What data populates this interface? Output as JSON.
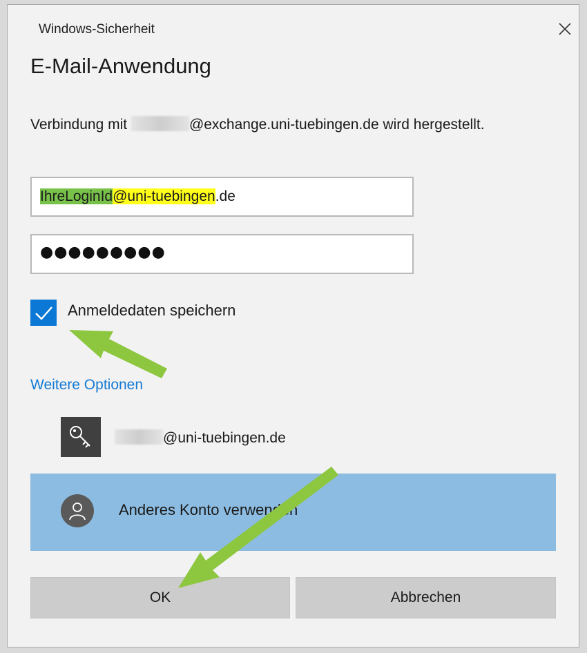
{
  "window": {
    "title": "Windows-Sicherheit",
    "close_icon": "close-icon"
  },
  "dialog": {
    "heading": "E-Mail-Anwendung",
    "description_prefix": "Verbindung mit",
    "description_suffix": "@exchange.uni-tuebingen.de wird hergestellt."
  },
  "username_field": {
    "value_part1": "IhreLoginId",
    "value_part2": "@uni-tuebingen",
    "value_part3": ".de",
    "highlight_colors": [
      "#79c24a",
      "#ffff1a"
    ]
  },
  "password_field": {
    "masked_value": "●●●●●●●●●"
  },
  "remember_credentials": {
    "label": "Anmeldedaten speichern",
    "checked": true
  },
  "more_options": {
    "label": "Weitere Optionen"
  },
  "saved_account": {
    "icon": "key-icon",
    "email_suffix": "@uni-tuebingen.de"
  },
  "other_account": {
    "icon": "user-icon",
    "label": "Anderes Konto verwenden"
  },
  "buttons": {
    "ok_label": "OK",
    "cancel_label": "Abbrechen"
  },
  "colors": {
    "accent": "#0a78d4",
    "link": "#1479d4",
    "selected_row": "#8cbce1",
    "annotation_arrow": "#8dc63f"
  }
}
